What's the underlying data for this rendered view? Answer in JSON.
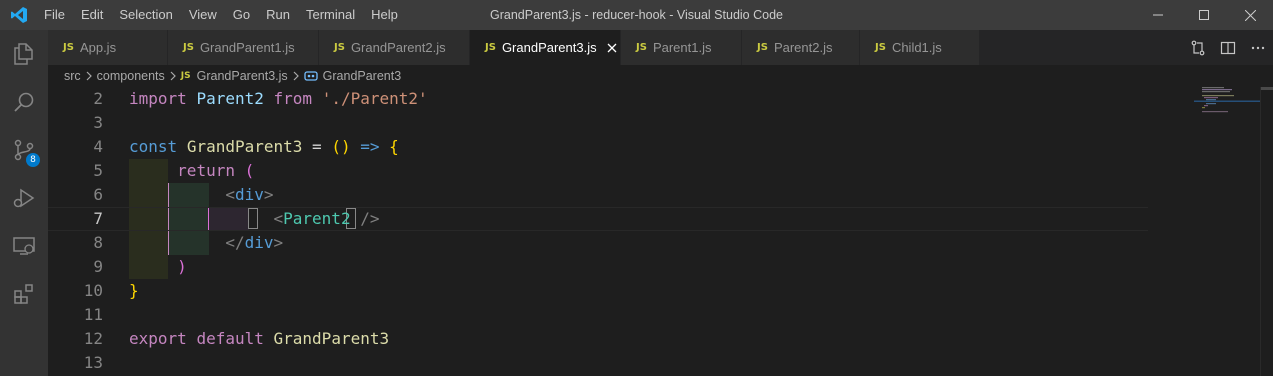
{
  "titlebar": {
    "menu": [
      "File",
      "Edit",
      "Selection",
      "View",
      "Go",
      "Run",
      "Terminal",
      "Help"
    ],
    "title": "GrandParent3.js - reducer-hook - Visual Studio Code"
  },
  "activity": {
    "scm_badge": "8"
  },
  "tabs": [
    {
      "label": "App.js",
      "icon": "JS"
    },
    {
      "label": "GrandParent1.js",
      "icon": "JS"
    },
    {
      "label": "GrandParent2.js",
      "icon": "JS"
    },
    {
      "label": "GrandParent3.js",
      "icon": "JS",
      "active": true
    },
    {
      "label": "Parent1.js",
      "icon": "JS"
    },
    {
      "label": "Parent2.js",
      "icon": "JS"
    },
    {
      "label": "Child1.js",
      "icon": "JS"
    }
  ],
  "breadcrumb": {
    "folder1": "src",
    "folder2": "components",
    "file_icon": "JS",
    "file": "GrandParent3.js",
    "symbol": "GrandParent3"
  },
  "editor": {
    "line_numbers": [
      "2",
      "3",
      "4",
      "5",
      "6",
      "7",
      "8",
      "9",
      "10",
      "11",
      "12",
      "13"
    ],
    "line2": {
      "import": "import",
      "name": "Parent2",
      "from": "from",
      "path": "'./Parent2'"
    },
    "line4": {
      "const": "const",
      "name": "GrandParent3",
      "eq": "=",
      "parens": "()",
      "arrow": "=>",
      "brace": "{"
    },
    "line5": {
      "return": "return",
      "paren": "("
    },
    "line6": {
      "open": "<",
      "tag": "div",
      "close": ">"
    },
    "line7": {
      "open": "<",
      "comp": "Parent2",
      "close": "/>"
    },
    "line8": {
      "open": "</",
      "tag": "div",
      "close": ">"
    },
    "line9": {
      "paren": ")"
    },
    "line10": {
      "brace": "}"
    },
    "line12": {
      "export": "export",
      "default": "default",
      "name": "GrandParent3"
    }
  },
  "colors": {
    "accent": "#007acc",
    "js_icon": "#cbcb41",
    "keyword": "#c586c0",
    "storage": "#569cd6",
    "function": "#dcdcaa",
    "string": "#ce9178",
    "component": "#4ec9b0"
  },
  "icons": [
    "vscode-logo-icon",
    "explorer-icon",
    "search-icon",
    "source-control-icon",
    "run-debug-icon",
    "remote-explorer-icon",
    "extensions-icon",
    "close-icon",
    "compare-changes-icon",
    "split-editor-icon",
    "more-actions-icon",
    "chevron-right-icon",
    "symbol-icon"
  ]
}
